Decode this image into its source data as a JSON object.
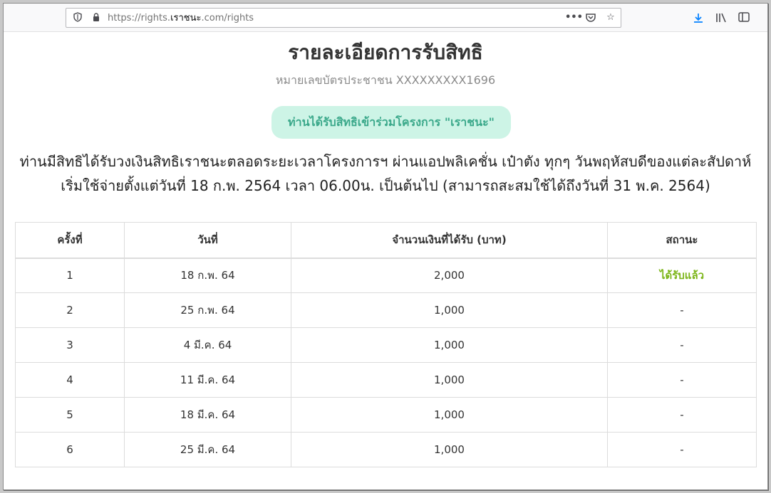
{
  "browser": {
    "url_prefix": "https://rights.",
    "url_host": "เราชนะ",
    "url_suffix": ".com/rights",
    "icons": {
      "shield": "shield-icon",
      "lock": "lock-icon",
      "more": "more-icon",
      "pocket": "pocket-icon",
      "bookmark": "star-icon",
      "download": "download-icon",
      "library": "library-icon",
      "sidebar": "sidebar-icon"
    }
  },
  "page": {
    "title": "รายละเอียดการรับสิทธิ",
    "id_label": "หมายเลขบัตรประชาชน XXXXXXXXX1696",
    "badge": "ท่านได้รับสิทธิเข้าร่วมโครงการ \"เราชนะ\"",
    "description_line1": "ท่านมีสิทธิได้รับวงเงินสิทธิเราชนะตลอดระยะเวลาโครงการฯ ผ่านแอปพลิเคชั่น เป๋าตัง ทุกๆ วันพฤหัสบดีของแต่ละสัปดาห์",
    "description_line2": "เริ่มใช้จ่ายตั้งแต่วันที่ 18 ก.พ. 2564 เวลา 06.00น. เป็นต้นไป (สามารถสะสมใช้ได้ถึงวันที่ 31 พ.ค. 2564)"
  },
  "table": {
    "headers": [
      "ครั้งที่",
      "วันที่",
      "จำนวนเงินที่ได้รับ (บาท)",
      "สถานะ"
    ],
    "rows": [
      [
        "1",
        "18 ก.พ. 64",
        "2,000",
        "ได้รับแล้ว"
      ],
      [
        "2",
        "25 ก.พ. 64",
        "1,000",
        "-"
      ],
      [
        "3",
        "4 มี.ค. 64",
        "1,000",
        "-"
      ],
      [
        "4",
        "11 มี.ค. 64",
        "1,000",
        "-"
      ],
      [
        "5",
        "18 มี.ค. 64",
        "1,000",
        "-"
      ],
      [
        "6",
        "25 มี.ค. 64",
        "1,000",
        "-"
      ]
    ]
  },
  "colors": {
    "badge_bg": "#cdf4e6",
    "badge_text": "#3aa88a",
    "status_received": "#7cb518"
  }
}
